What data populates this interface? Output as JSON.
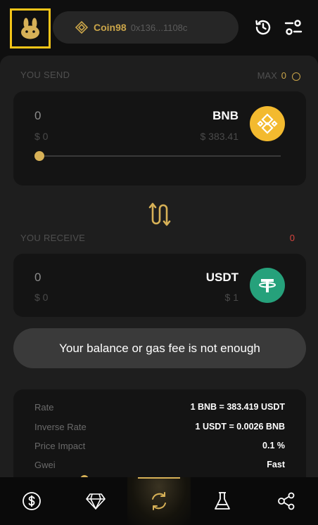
{
  "header": {
    "wallet": {
      "name": "Coin98",
      "address": "0x136...1108c"
    }
  },
  "send": {
    "label": "YOU SEND",
    "max_label": "MAX",
    "max_value": "0",
    "amount": "0",
    "usd": "$ 0",
    "symbol": "BNB",
    "price": "$ 383.41",
    "slider_fraction": 0
  },
  "receive": {
    "label": "YOU RECEIVE",
    "value": "0",
    "amount": "0",
    "usd": "$ 0",
    "symbol": "USDT",
    "price": "$ 1"
  },
  "warning": "Your balance or gas fee is not enough",
  "details": [
    {
      "key": "Rate",
      "value": "1 BNB = 383.419 USDT"
    },
    {
      "key": "Inverse Rate",
      "value": "1 USDT = 0.0026 BNB"
    },
    {
      "key": "Price Impact",
      "value": "0.1 %"
    },
    {
      "key": "Gwei",
      "value": "Fast"
    }
  ],
  "colors": {
    "accent": "#d7b157",
    "bnb": "#f3ba2f",
    "usdt": "#26a17b",
    "error": "#d8453e"
  },
  "nav": {
    "items": [
      "dollar-icon",
      "diamond-icon",
      "swap-icon",
      "flask-icon",
      "share-icon"
    ],
    "active": "swap-icon"
  }
}
